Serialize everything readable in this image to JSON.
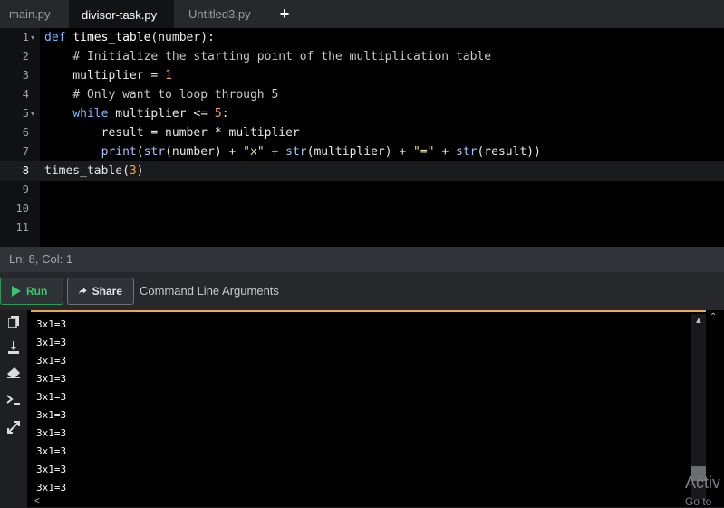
{
  "tabs": [
    {
      "label": "main.py",
      "active": false
    },
    {
      "label": "divisor-task.py",
      "active": true
    },
    {
      "label": "Untitled3.py",
      "active": false
    }
  ],
  "new_tab_label": "+",
  "editor": {
    "line_numbers": [
      "1",
      "2",
      "3",
      "4",
      "5",
      "6",
      "7",
      "8",
      "9",
      "10",
      "11"
    ],
    "current_line": 8,
    "lines": [
      [
        {
          "t": "def",
          "c": "kw"
        },
        {
          "t": " "
        },
        {
          "t": "times_table",
          "c": "fn"
        },
        {
          "t": "(number):"
        }
      ],
      [
        {
          "t": "    "
        },
        {
          "t": "# Initialize the starting point of the multiplication table",
          "c": "cm"
        }
      ],
      [
        {
          "t": "    multiplier = "
        },
        {
          "t": "1",
          "c": "num"
        }
      ],
      [
        {
          "t": "    "
        },
        {
          "t": "# Only want to loop through 5",
          "c": "cm"
        }
      ],
      [
        {
          "t": "    "
        },
        {
          "t": "while",
          "c": "kw"
        },
        {
          "t": " multiplier <= "
        },
        {
          "t": "5",
          "c": "num"
        },
        {
          "t": ":"
        }
      ],
      [
        {
          "t": "        result = number * multiplier"
        }
      ],
      [
        {
          "t": "        "
        },
        {
          "t": "print",
          "c": "bi"
        },
        {
          "t": "("
        },
        {
          "t": "str",
          "c": "bi"
        },
        {
          "t": "(number) + "
        },
        {
          "t": "\"x\"",
          "c": "str"
        },
        {
          "t": " + "
        },
        {
          "t": "str",
          "c": "bi"
        },
        {
          "t": "(multiplier) + "
        },
        {
          "t": "\"=\"",
          "c": "str"
        },
        {
          "t": " + "
        },
        {
          "t": "str",
          "c": "bi"
        },
        {
          "t": "(result))"
        }
      ],
      [
        {
          "t": "times_table"
        },
        {
          "t": "("
        },
        {
          "t": "3",
          "c": "num"
        },
        {
          "t": ")"
        }
      ],
      [],
      [],
      []
    ]
  },
  "status": {
    "text": "Ln: 8,  Col: 1"
  },
  "toolbar": {
    "run_label": "Run",
    "share_label": "Share",
    "cla_label": "Command Line Arguments"
  },
  "console": {
    "output_lines": [
      "3x1=3",
      "3x1=3",
      "3x1=3",
      "3x1=3",
      "3x1=3",
      "3x1=3",
      "3x1=3",
      "3x1=3",
      "3x1=3",
      "3x1=3"
    ],
    "icons": [
      "copy-icon",
      "download-icon",
      "eraser-icon",
      "terminal-icon",
      "expand-icon"
    ]
  },
  "watermark": {
    "line1": "Activ",
    "line2": "Go to"
  },
  "colors": {
    "accent": "#f0a35a",
    "run_green": "#3cc46d"
  }
}
